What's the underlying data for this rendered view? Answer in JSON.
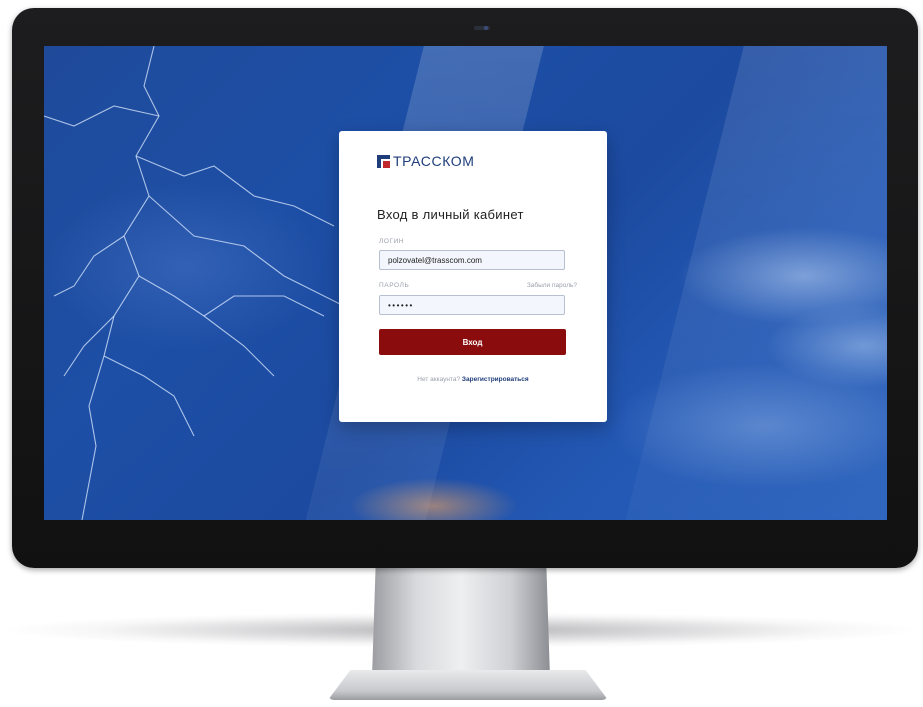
{
  "brand": {
    "name": "ТРАССКОМ",
    "logo_icon": "trasscom-logo-mark",
    "colors": {
      "brand_blue": "#1f3d7a",
      "brand_red": "#c0282d",
      "button": "#8a0c0c"
    }
  },
  "login_form": {
    "title": "Вход в личный кабинет",
    "login_label": "ЛОГИН",
    "login_value": "polzovatel@trasscom.com",
    "password_label": "ПАРОЛЬ",
    "password_value": "••••••",
    "forgot_password": "Забыли пароль?",
    "submit_label": "Вход",
    "no_account_text": "Нет аккаунта?",
    "register_link": "Зарегистрироваться"
  }
}
